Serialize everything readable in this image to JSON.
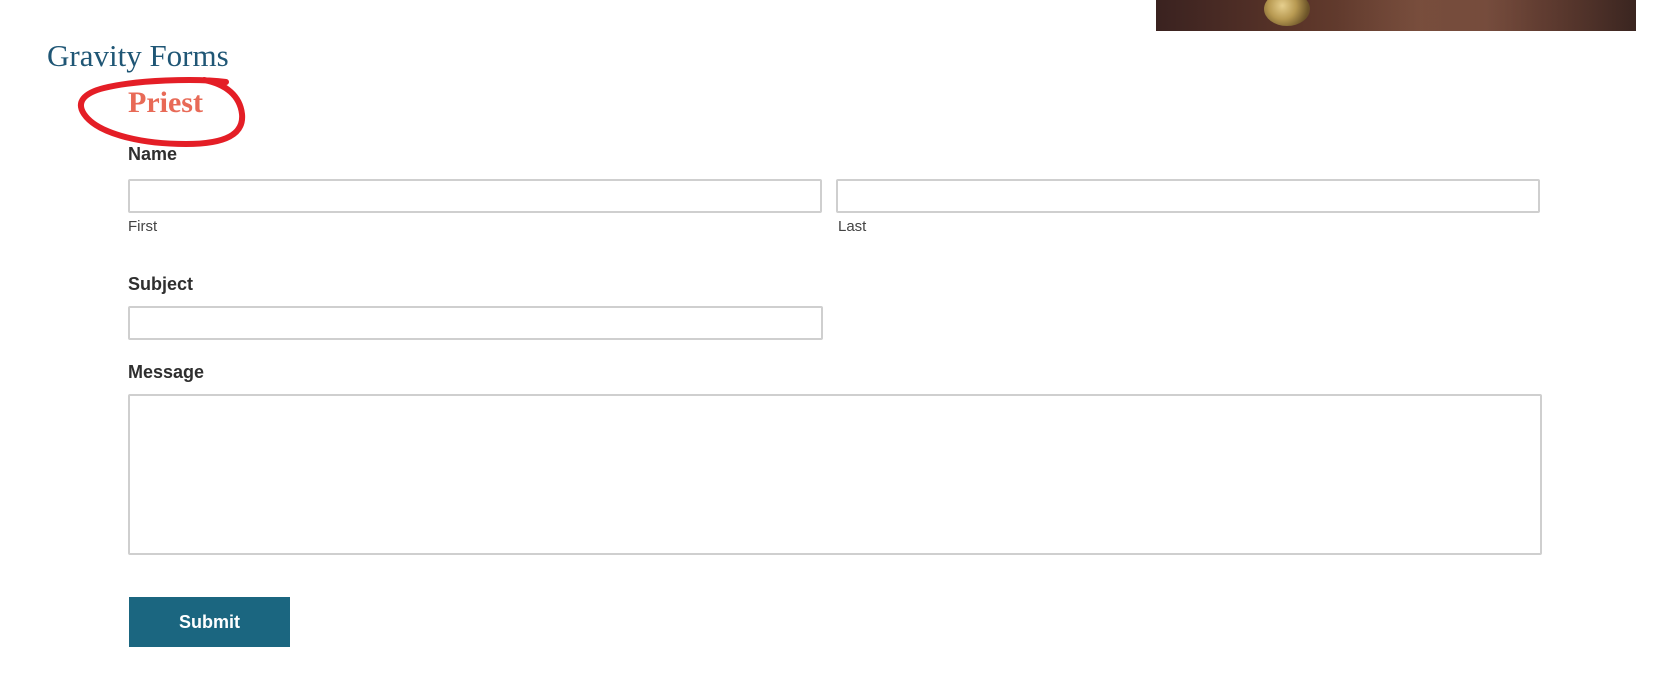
{
  "page": {
    "title": "Gravity Forms"
  },
  "form": {
    "title": "Priest",
    "name": {
      "label": "Name",
      "first": {
        "sub_label": "First",
        "value": ""
      },
      "last": {
        "sub_label": "Last",
        "value": ""
      }
    },
    "subject": {
      "label": "Subject",
      "value": ""
    },
    "message": {
      "label": "Message",
      "value": ""
    },
    "submit_label": "Submit"
  },
  "colors": {
    "page_title": "#1f5675",
    "form_title": "#e86a57",
    "annotation": "#e41e26",
    "button_bg": "#1b6680",
    "input_border": "#cfcfcf"
  }
}
